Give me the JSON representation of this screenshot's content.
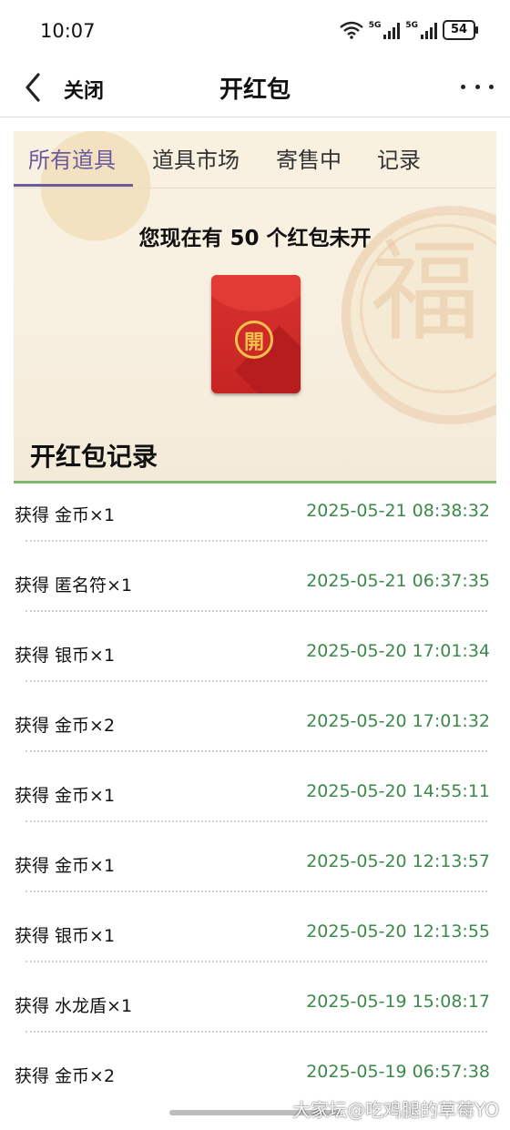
{
  "status_bar": {
    "time": "10:07",
    "wifi_icon": "wifi-icon",
    "signal_1_label": "5G",
    "signal_2_label": "5G",
    "battery": "54"
  },
  "nav": {
    "back_icon": "chevron-left-icon",
    "close_label": "关闭",
    "title": "开红包",
    "more_icon": "more-horizontal-icon"
  },
  "tabs": [
    {
      "label": "所有道具",
      "active": true
    },
    {
      "label": "道具市场",
      "active": false
    },
    {
      "label": "寄售中",
      "active": false
    },
    {
      "label": "记录",
      "active": false
    }
  ],
  "banner": {
    "unopened_text": "您现在有 50 个红包未开",
    "envelope_seal": "開",
    "background_character": "福"
  },
  "records_title": "开红包记录",
  "records": [
    {
      "item": "获得 金币×1",
      "time": "2025-05-21 08:38:32"
    },
    {
      "item": "获得 匿名符×1",
      "time": "2025-05-21 06:37:35"
    },
    {
      "item": "获得 银币×1",
      "time": "2025-05-20 17:01:34"
    },
    {
      "item": "获得 金币×2",
      "time": "2025-05-20 17:01:32"
    },
    {
      "item": "获得 金币×1",
      "time": "2025-05-20 14:55:11"
    },
    {
      "item": "获得 金币×1",
      "time": "2025-05-20 12:13:57"
    },
    {
      "item": "获得 银币×1",
      "time": "2025-05-20 12:13:55"
    },
    {
      "item": "获得 水龙盾×1",
      "time": "2025-05-19 15:08:17"
    },
    {
      "item": "获得 金币×2",
      "time": "2025-05-19 06:57:38"
    }
  ],
  "watermark": "大家坛@吃鸡腿的草莓YO",
  "colors": {
    "tab_active": "#6b5aa0",
    "time_green": "#3b8a49",
    "divider_green": "#7bbb6b",
    "envelope_red": "#d8322f",
    "seal_gold": "#f0c14b"
  }
}
